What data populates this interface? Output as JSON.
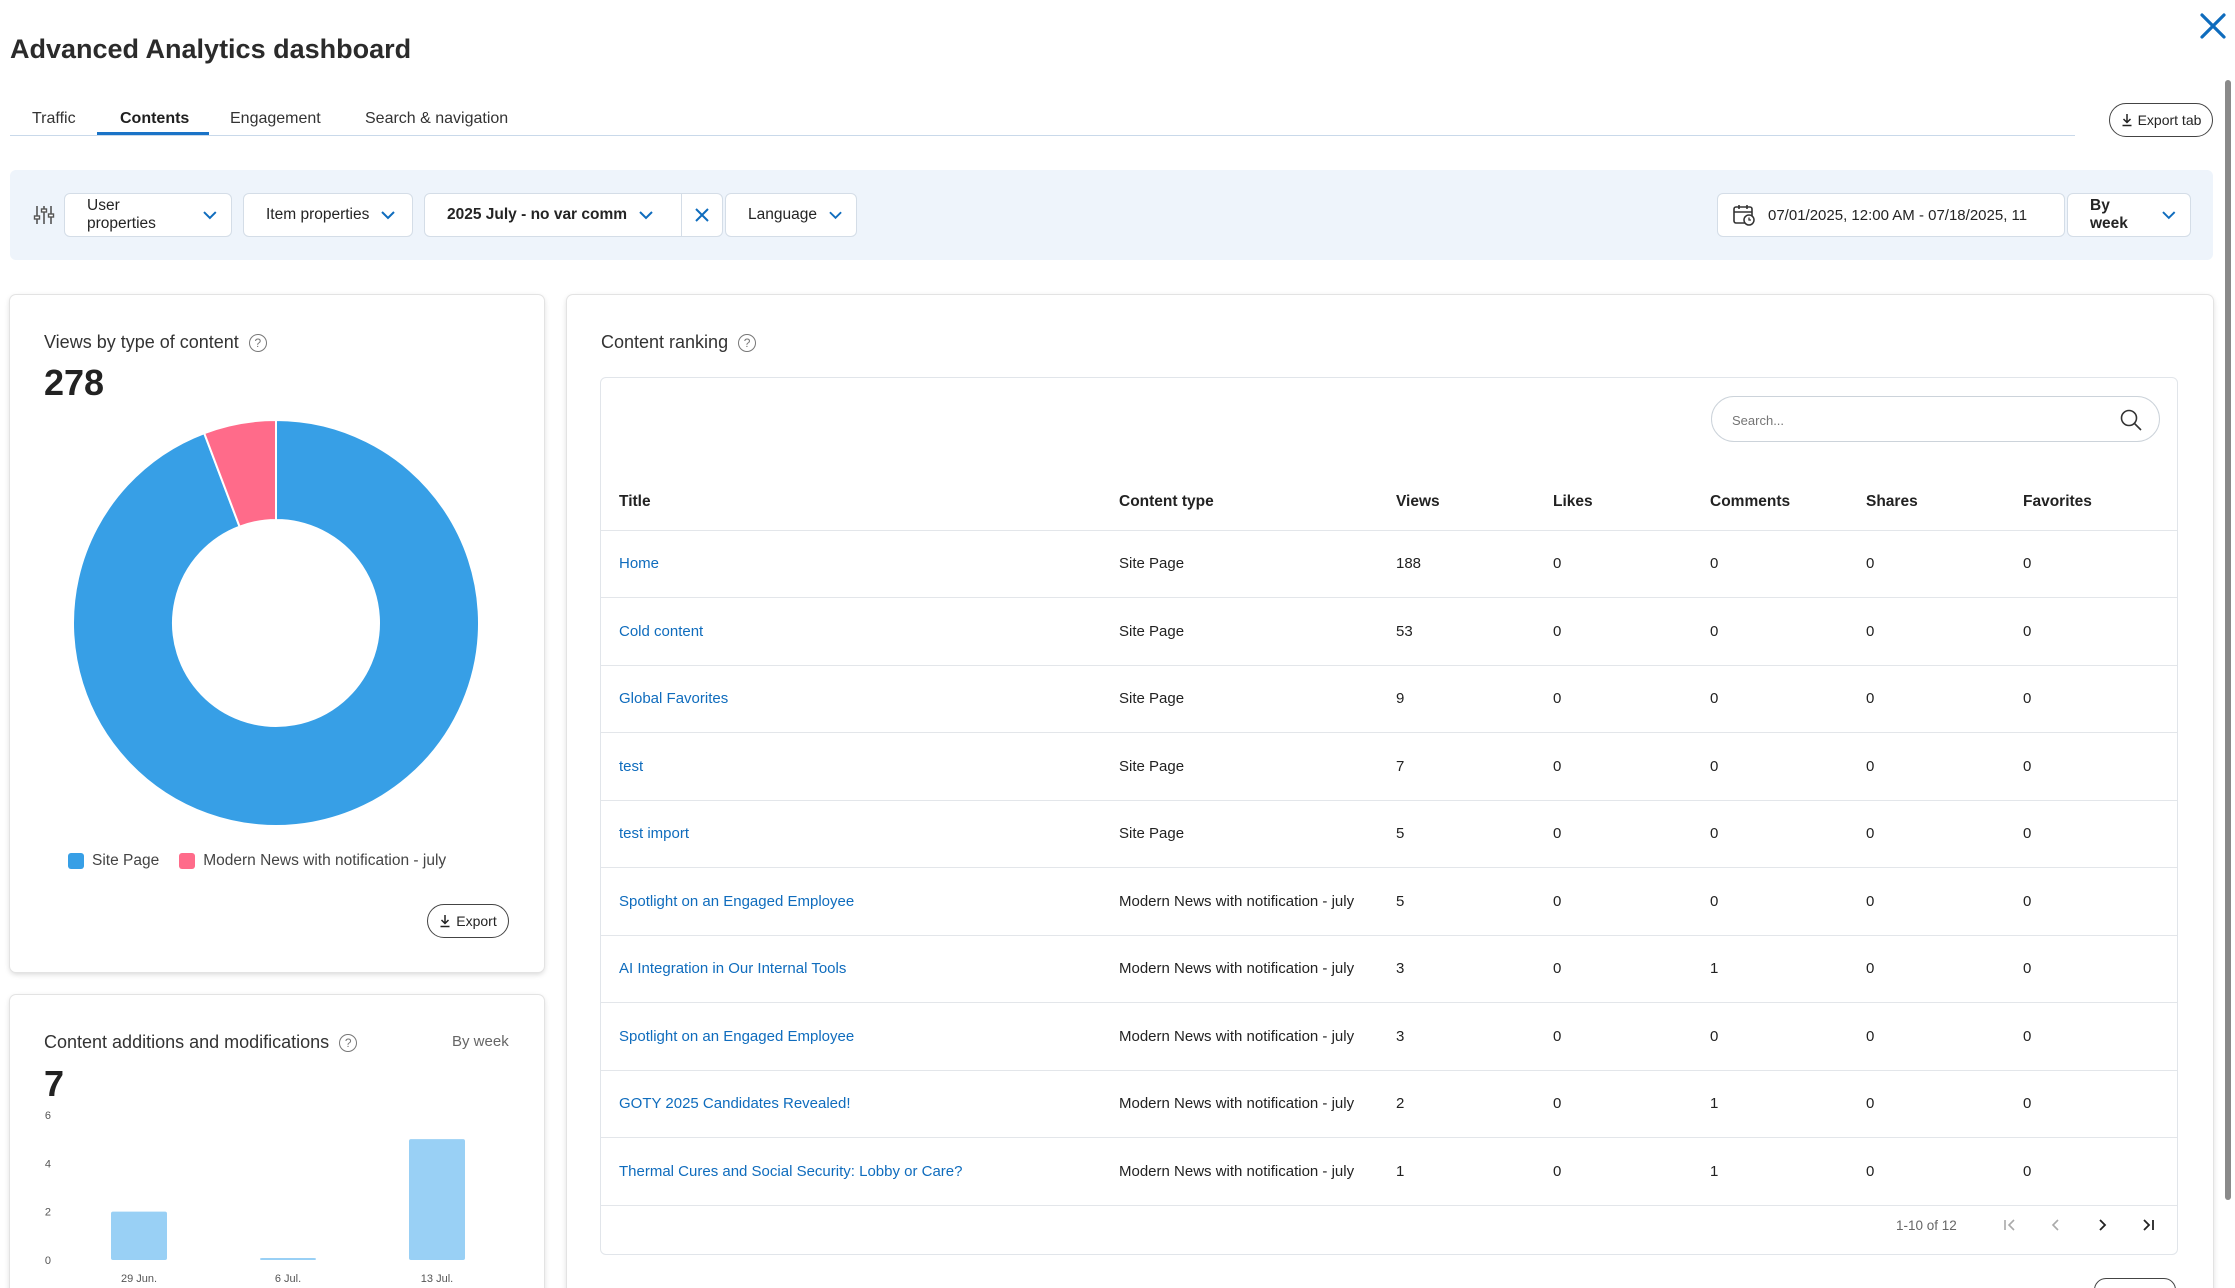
{
  "app": {
    "title": "Advanced Analytics dashboard"
  },
  "tabs": [
    {
      "label": "Traffic"
    },
    {
      "label": "Contents"
    },
    {
      "label": "Engagement"
    },
    {
      "label": "Search & navigation"
    }
  ],
  "active_tab": "Contents",
  "export_tab_label": "Export tab",
  "filters": {
    "user_properties": "User properties",
    "item_properties": "Item properties",
    "selected_filter": "2025 July - no var comm",
    "language": "Language",
    "date_range": "07/01/2025, 12:00 AM - 07/18/2025, 11",
    "granularity": "By week"
  },
  "views_card": {
    "title": "Views by type of content",
    "total": "278",
    "export_label": "Export",
    "legend": [
      {
        "label": "Site Page",
        "color": "#379fe6"
      },
      {
        "label": "Modern News with notification - july",
        "color": "#ff6b8a"
      }
    ]
  },
  "chart_data": [
    {
      "type": "pie",
      "title": "Views by type of content",
      "categories": [
        "Site Page",
        "Modern News with notification - july"
      ],
      "values": [
        262,
        16
      ]
    },
    {
      "type": "bar",
      "title": "Content additions and modifications",
      "categories": [
        "29 Jun.",
        "6 Jul.",
        "13 Jul."
      ],
      "values": [
        2,
        0,
        5
      ],
      "yticks": [
        "0",
        "2",
        "4",
        "6"
      ],
      "ylim": [
        0,
        6
      ]
    }
  ],
  "additions_card": {
    "title": "Content additions and modifications",
    "total": "7",
    "granularity": "By week"
  },
  "ranking": {
    "title": "Content ranking",
    "search_placeholder": "Search...",
    "columns": [
      "Title",
      "Content type",
      "Views",
      "Likes",
      "Comments",
      "Shares",
      "Favorites"
    ],
    "rows": [
      [
        "Home",
        "Site Page",
        "188",
        "0",
        "0",
        "0",
        "0"
      ],
      [
        "Cold content",
        "Site Page",
        "53",
        "0",
        "0",
        "0",
        "0"
      ],
      [
        "Global Favorites",
        "Site Page",
        "9",
        "0",
        "0",
        "0",
        "0"
      ],
      [
        "test",
        "Site Page",
        "7",
        "0",
        "0",
        "0",
        "0"
      ],
      [
        "test import",
        "Site Page",
        "5",
        "0",
        "0",
        "0",
        "0"
      ],
      [
        "Spotlight on an Engaged Employee",
        "Modern News with notification - july",
        "5",
        "0",
        "0",
        "0",
        "0"
      ],
      [
        "AI Integration in Our Internal Tools",
        "Modern News with notification - july",
        "3",
        "0",
        "1",
        "0",
        "0"
      ],
      [
        "Spotlight on an Engaged Employee",
        "Modern News with notification - july",
        "3",
        "0",
        "0",
        "0",
        "0"
      ],
      [
        "GOTY 2025 Candidates Revealed!",
        "Modern News with notification - july",
        "2",
        "0",
        "1",
        "0",
        "0"
      ],
      [
        "Thermal Cures and Social Security: Lobby or Care?",
        "Modern News with notification - july",
        "1",
        "0",
        "1",
        "0",
        "0"
      ]
    ],
    "pagination": "1-10 of 12"
  }
}
